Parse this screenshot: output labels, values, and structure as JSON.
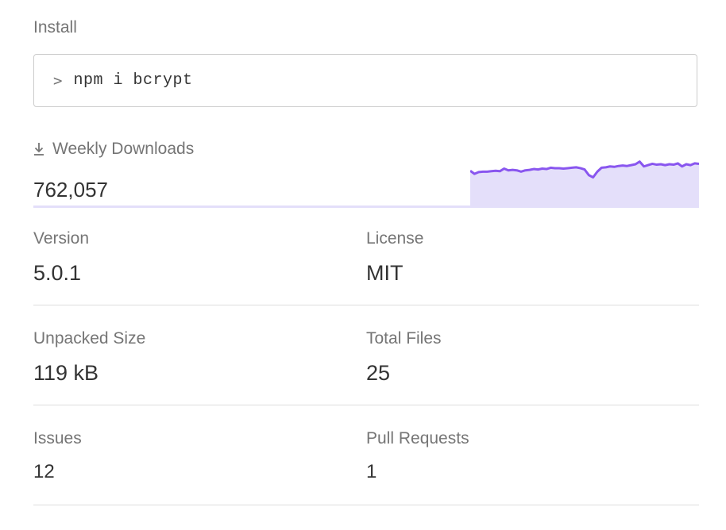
{
  "install": {
    "heading": "Install",
    "prompt_icon": "chevron-right-icon",
    "command": "npm i bcrypt"
  },
  "downloads": {
    "icon": "download-icon",
    "heading": "Weekly Downloads",
    "value": "762,057"
  },
  "colors": {
    "accent_line": "#8956ef",
    "accent_fill": "#e4dffa",
    "label": "#757575",
    "value": "#333333",
    "divider": "#dddddd"
  },
  "chart_data": {
    "type": "area",
    "title": "",
    "xlabel": "",
    "ylabel": "",
    "series": [
      {
        "values": [
          735,
          728,
          732,
          733,
          733,
          734,
          735,
          734,
          740,
          736,
          737,
          736,
          733,
          736,
          737,
          739,
          738,
          740,
          739,
          742,
          741,
          741,
          740,
          741,
          742,
          743,
          741,
          738,
          725,
          720,
          733,
          742,
          743,
          745,
          744,
          746,
          747,
          746,
          748,
          750,
          756,
          745,
          748,
          751,
          749,
          750,
          748,
          750,
          749,
          752,
          745,
          750,
          748,
          752,
          751
        ]
      }
    ],
    "ylim": [
      650,
      770
    ],
    "grid": false,
    "legend": "none"
  },
  "stats": {
    "version": {
      "label": "Version",
      "value": "5.0.1"
    },
    "license": {
      "label": "License",
      "value": "MIT"
    },
    "unpacked_size": {
      "label": "Unpacked Size",
      "value": "119 kB"
    },
    "total_files": {
      "label": "Total Files",
      "value": "25"
    },
    "issues": {
      "label": "Issues",
      "value": "12"
    },
    "pull_requests": {
      "label": "Pull Requests",
      "value": "1"
    }
  }
}
